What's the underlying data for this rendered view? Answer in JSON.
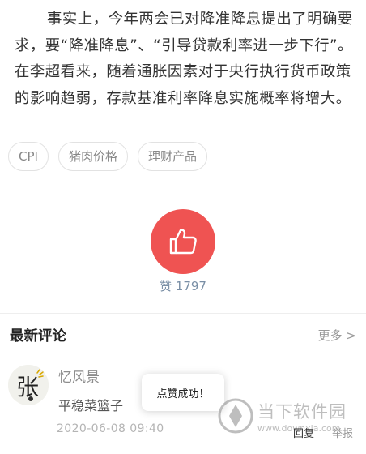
{
  "article": {
    "paragraph": "事实上，今年两会已对降准降息提出了明确要求，要“降准降息”、“引导贷款利率进一步下行”。在李超看来，随着通胀因素对于央行执行货币政策的影响趋弱，存款基准利率降息实施概率将增大。"
  },
  "tags": [
    {
      "label": "CPI"
    },
    {
      "label": "猪肉价格"
    },
    {
      "label": "理财产品"
    }
  ],
  "like": {
    "icon": "thumbs-up-icon",
    "count_label": "赞 1797",
    "accent_color": "#ef5352"
  },
  "comments": {
    "title": "最新评论",
    "more_label": "更多 >",
    "items": [
      {
        "avatar_char": "张",
        "username": "忆风景",
        "text": "平稳菜篮子",
        "time": "2020-06-08 09:40",
        "reply_label": "回复",
        "report_label": "举报"
      }
    ]
  },
  "toast": {
    "text": "点赞成功！"
  },
  "watermark": {
    "text": "当下软件园",
    "url": "www.downxia.com"
  }
}
